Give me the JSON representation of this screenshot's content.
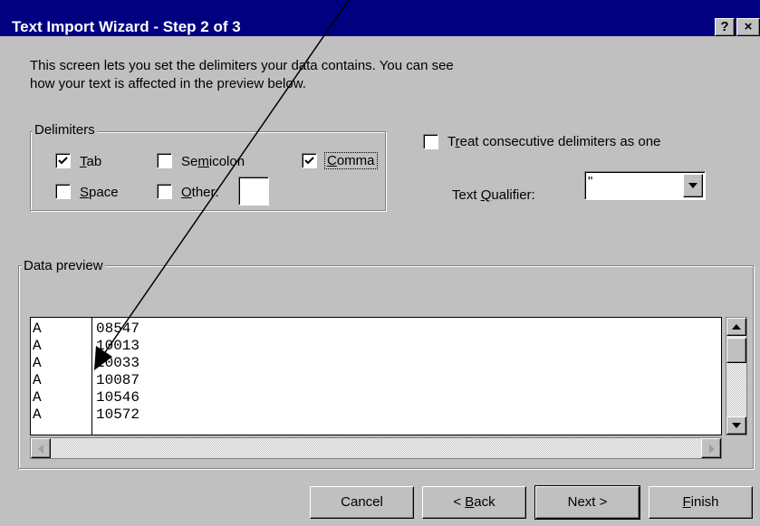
{
  "window": {
    "title": "Text Import Wizard - Step 2 of 3",
    "help_button": "?",
    "close_button": "×"
  },
  "intro_line1": "This screen lets you set the delimiters your data contains.  You can see",
  "intro_line2": "how your text is affected in the preview below.",
  "delimiters": {
    "legend": "Delimiters",
    "tab": {
      "label_u": "T",
      "label_rest": "ab",
      "checked": true
    },
    "semicolon": {
      "label_pre": "Se",
      "label_u": "m",
      "label_rest": "icolon",
      "checked": false
    },
    "comma": {
      "label_u": "C",
      "label_rest": "omma",
      "checked": true
    },
    "space": {
      "label_u": "S",
      "label_rest": "pace",
      "checked": false
    },
    "other": {
      "label_u": "O",
      "label_rest": "ther:",
      "checked": false,
      "value": ""
    }
  },
  "consecutive": {
    "label_pre": "T",
    "label_u": "r",
    "label_rest": "eat consecutive delimiters as one",
    "checked": false
  },
  "qualifier": {
    "label_pre": "Text ",
    "label_u": "Q",
    "label_rest": "ualifier:",
    "value": "\""
  },
  "preview": {
    "legend": "Data preview",
    "rows": [
      {
        "c1": "A",
        "c2": "08547"
      },
      {
        "c1": "A",
        "c2": "10013"
      },
      {
        "c1": "A",
        "c2": "10033"
      },
      {
        "c1": "A",
        "c2": "10087"
      },
      {
        "c1": "A",
        "c2": "10546"
      },
      {
        "c1": "A",
        "c2": "10572"
      }
    ]
  },
  "buttons": {
    "cancel": "Cancel",
    "back_pre": "< ",
    "back_u": "B",
    "back_rest": "ack",
    "next": "Next >",
    "finish_u": "F",
    "finish_rest": "inish"
  },
  "colors": {
    "titlebar": "#000080",
    "face": "#c0c0c0",
    "annotation_arrow": "#000000"
  }
}
